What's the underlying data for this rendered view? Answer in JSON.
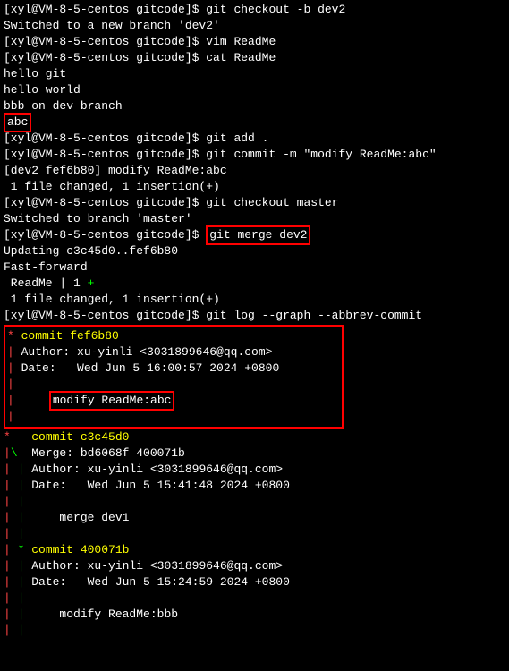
{
  "prompt": "[xyl@VM-8-5-centos gitcode]$ ",
  "cmd": {
    "checkout_b": "git checkout -b dev2",
    "vim": "vim ReadMe",
    "cat": "cat ReadMe",
    "add": "git add .",
    "commit": "git commit -m \"modify ReadMe:abc\"",
    "checkout_master": "git checkout master",
    "merge": "git merge dev2",
    "log": "git log --graph --abbrev-commit"
  },
  "out": {
    "switched_new": "Switched to a new branch 'dev2'",
    "cat1": "hello git",
    "cat2": "hello world",
    "cat3": "bbb on dev branch",
    "cat4": "abc",
    "commit_head": "[dev2 fef6b80] modify ReadMe:abc",
    "commit_stat": " 1 file changed, 1 insertion(+)",
    "switched_master": "Switched to branch 'master'",
    "updating": "Updating c3c45d0..fef6b80",
    "ff": "Fast-forward",
    "ff_file": " ReadMe | 1 ",
    "ff_plus": "+",
    "ff_stat": " 1 file changed, 1 insertion(+)"
  },
  "log1": {
    "star": "* ",
    "commit_label": "commit fef6b80",
    "pipe": "| ",
    "author": "Author: xu-yinli <3031899646@qq.com>",
    "date": "Date:   Wed Jun 5 16:00:57 2024 +0800",
    "empty": "",
    "msg_prefix": "    ",
    "msg": "modify ReadMe:abc"
  },
  "log2": {
    "l1a": "*   ",
    "l1b": "commit c3c45d0",
    "l2a": "|",
    "l2b": "\\",
    "l2c": "  Merge: bd6068f 400071b",
    "l3a": "| ",
    "l3b": "| ",
    "l3c": "Author: xu-yinli <3031899646@qq.com>",
    "l4c": "Date:   Wed Jun 5 15:41:48 2024 +0800",
    "l5c": "",
    "l6c": "    merge dev1",
    "l7c": ""
  },
  "log3": {
    "pa": "| ",
    "pb": "* ",
    "commit": "commit 400071b",
    "author": "Author: xu-yinli <3031899646@qq.com>",
    "date": "Date:   Wed Jun 5 15:24:59 2024 +0800",
    "msg": "    modify ReadMe:bbb"
  }
}
